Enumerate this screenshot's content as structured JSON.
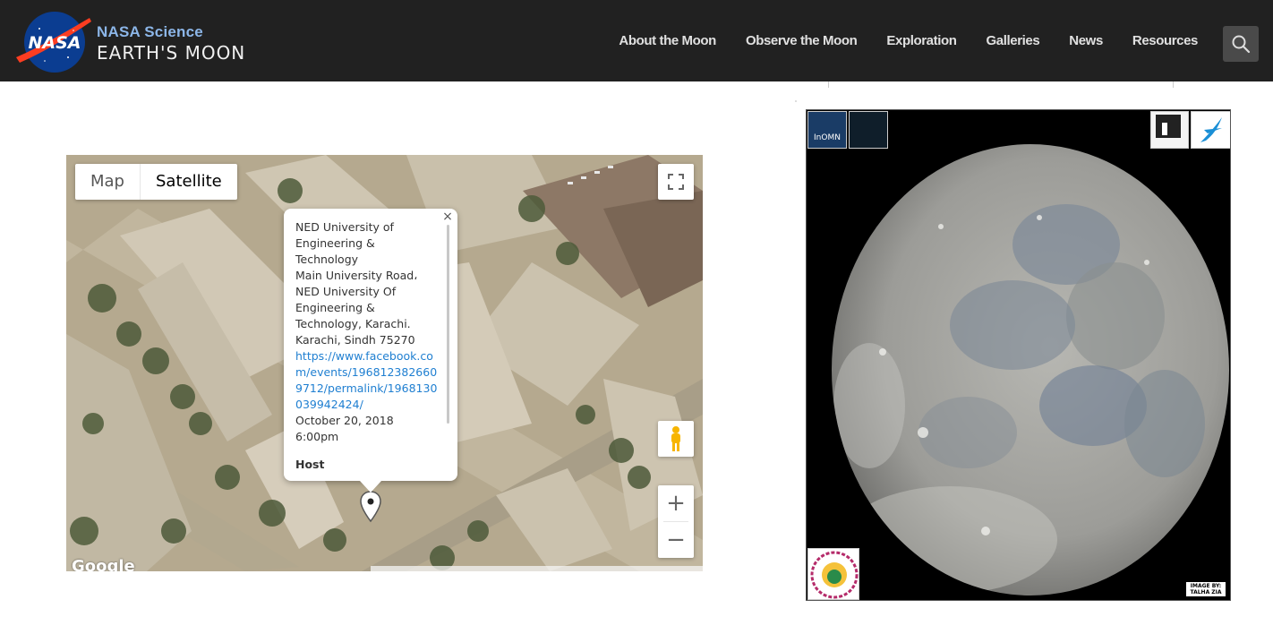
{
  "header": {
    "logo_text": "NASA",
    "brand_top": "NASA Science",
    "brand_bottom": "EARTH'S MOON",
    "nav": [
      "About the Moon",
      "Observe the Moon",
      "Exploration",
      "Galleries",
      "News",
      "Resources"
    ],
    "colors": {
      "bar": "#212121",
      "brand_accent": "#8cb6e8"
    }
  },
  "map": {
    "type_buttons": {
      "map": "Map",
      "satellite": "Satellite"
    },
    "selected_type": "Satellite",
    "provider_logo": "Google",
    "zoom_in": "+",
    "zoom_out": "−",
    "info_window": {
      "close": "×",
      "lines": [
        "NED University of",
        "Engineering &",
        "Technology",
        "Main University Road،",
        "NED University Of",
        "Engineering &",
        "Technology, Karachi.",
        "Karachi, Sindh 75270"
      ],
      "link": "https://www.facebook.com/events/1968123826609712/permalink/1968130039942424/",
      "date": "October 20, 2018",
      "time": "6:00pm",
      "host_label": "Host"
    }
  },
  "moon_image": {
    "badges": [
      "InOMN"
    ],
    "credit_line1": "IMAGE BY:",
    "credit_line2": "TALHA ZIA"
  }
}
